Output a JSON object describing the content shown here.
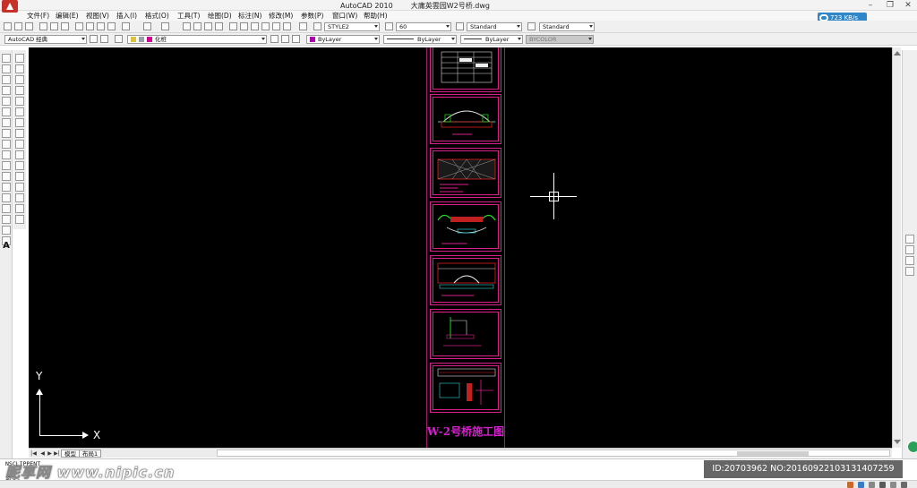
{
  "window": {
    "app_title": "AutoCAD 2010",
    "file_title": "大庸英雲园W2号桥.dwg",
    "min": "–",
    "max": "❐",
    "close": "✕"
  },
  "menu": [
    "文件(F)",
    "编辑(E)",
    "视图(V)",
    "插入(I)",
    "格式(O)",
    "工具(T)",
    "绘图(D)",
    "标注(N)",
    "修改(M)",
    "参数(P)",
    "窗口(W)",
    "帮助(H)"
  ],
  "net_speed": "723 KB/s",
  "toolbar1": {
    "text_style": "STYLE2",
    "text_height": "60",
    "dim_style": "Standard",
    "table_style": "Standard"
  },
  "toolbar2": {
    "workspace": "AutoCAD 经典",
    "layer": "化桩",
    "color": "ByLayer",
    "linetype": "ByLayer",
    "lineweight": "ByLayer",
    "plotstyle": "BYCOLOR"
  },
  "canvas": {
    "drawing_title": "W-2号桥施工图",
    "ucs_x": "X",
    "ucs_y": "Y"
  },
  "tabs": [
    "模型",
    "布局1"
  ],
  "command": {
    "line1": "NSCLIPPENT",
    "line2": "命令:"
  },
  "watermark": "昵享网 www.nipic.cn",
  "image_id": "ID:20703962 NO:20160922103131407259",
  "colors": {
    "canvas": "#000000",
    "sheet_border": "#d81f8a",
    "title_magenta": "#d81fd0",
    "accent_blue": "#2f86c8"
  }
}
